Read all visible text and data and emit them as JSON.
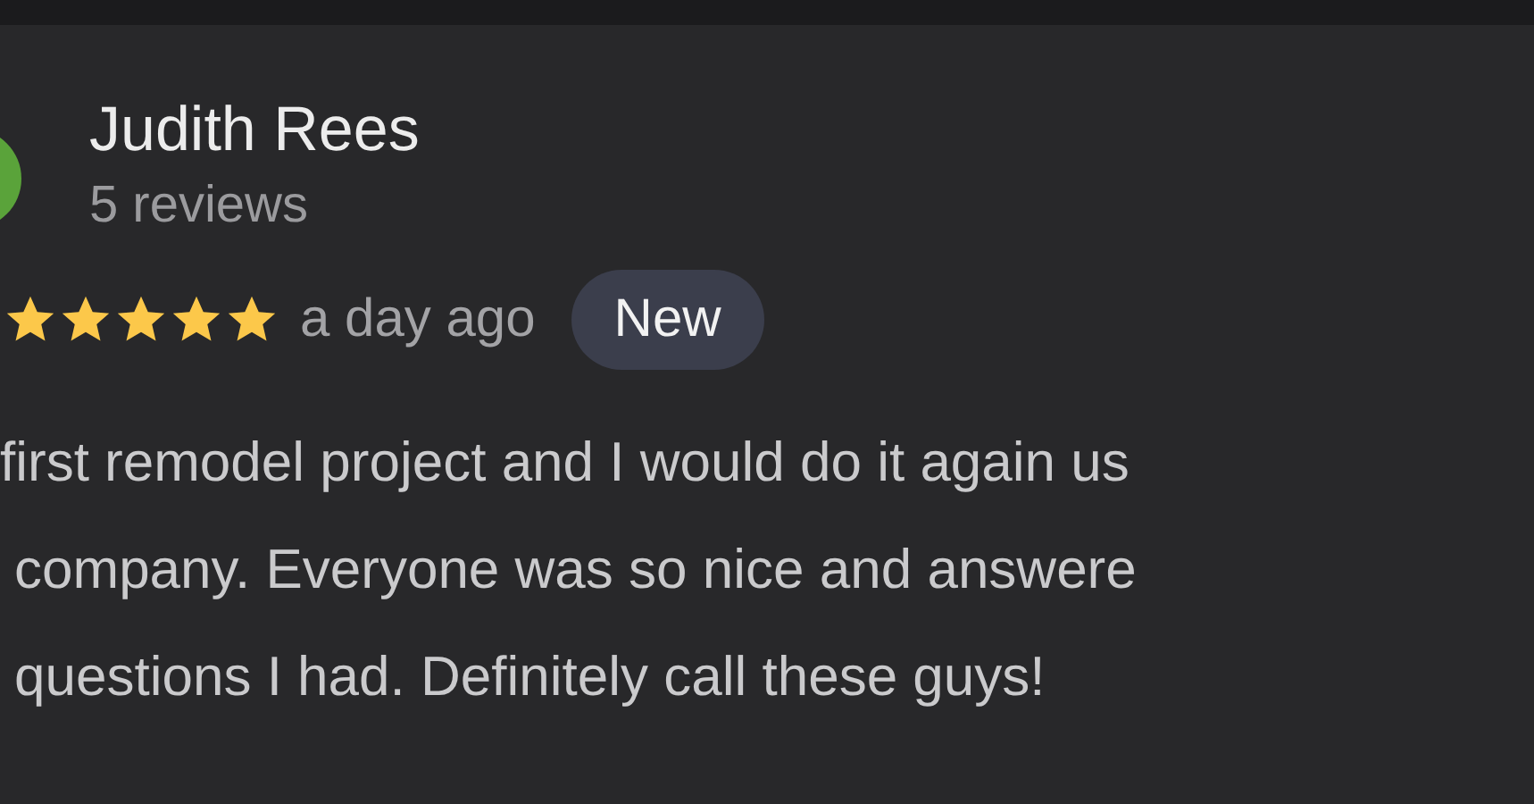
{
  "review": {
    "author": "Judith Rees",
    "review_count": "5 reviews",
    "stars": 5,
    "time": "a day ago",
    "badge": "New",
    "text_lines": [
      "first remodel project and I would do it again us",
      "company. Everyone was so nice and answere",
      "questions I had. Definitely call these guys!"
    ]
  }
}
